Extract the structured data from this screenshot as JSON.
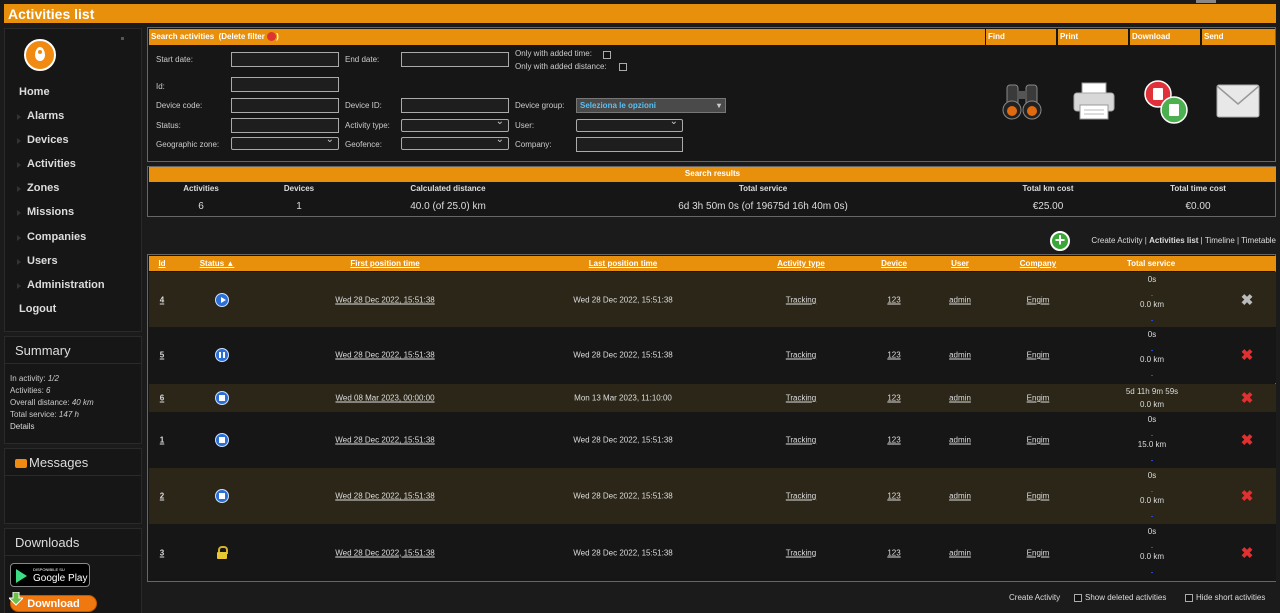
{
  "title": "Activities list",
  "nav": [
    "Home",
    "Alarms",
    "Devices",
    "Activities",
    "Zones",
    "Missions",
    "Companies",
    "Users",
    "Administration",
    "Logout"
  ],
  "summary": {
    "title": "Summary",
    "in_activity_label": "In activity:",
    "in_activity": "1/2",
    "activities_label": "Activities:",
    "activities": "6",
    "distance_label": "Overall distance:",
    "distance": "40 km",
    "service_label": "Total service:",
    "service": "147 h",
    "details": "Details"
  },
  "messages_title": "Messages",
  "downloads": {
    "title": "Downloads",
    "gplay_small": "DISPONIBILE SU",
    "gplay_big": "Google Play",
    "download": "Download"
  },
  "search": {
    "header": "Search activities",
    "delete_filter": "Delete filter",
    "start_date": "Start date:",
    "end_date": "End date:",
    "only_time": "Only with added time:",
    "only_distance": "Only with added distance:",
    "id": "Id:",
    "device_code": "Device code:",
    "device_id": "Device ID:",
    "device_group": "Device group:",
    "device_group_placeholder": "Seleziona le opzioni",
    "status": "Status:",
    "activity_type": "Activity type:",
    "user": "User:",
    "geo_zone": "Geographic zone:",
    "geofence": "Geofence:",
    "company": "Company:",
    "find": "Find",
    "print": "Print",
    "download": "Download",
    "send": "Send"
  },
  "results": {
    "header": "Search results",
    "cols": [
      "Activities",
      "Devices",
      "Calculated distance",
      "Total service",
      "Total km cost",
      "Total time cost"
    ],
    "values": [
      "6",
      "1",
      "40.0 (of 25.0) km",
      "6d 3h 50m 0s (of 19675d 16h 40m 0s)",
      "€25.00",
      "€0.00"
    ]
  },
  "links": {
    "create": "Create Activity",
    "list": "Activities list",
    "timeline": "Timeline",
    "timetable": "Timetable"
  },
  "table": {
    "headers": [
      "Id",
      "Status",
      "First position time",
      "Last position time",
      "Activity type",
      "Device",
      "User",
      "Company",
      "Total service"
    ],
    "rows": [
      {
        "id": "4",
        "status": "play",
        "first": "Wed 28 Dec 2022, 15:51:38",
        "last": "Wed 28 Dec 2022, 15:51:38",
        "type": "Tracking",
        "device": "123",
        "user": "admin",
        "company": "Engim",
        "svc1": "0s",
        "svc2": "0.0 km"
      },
      {
        "id": "5",
        "status": "pause",
        "first": "Wed 28 Dec 2022, 15:51:38",
        "last": "Wed 28 Dec 2022, 15:51:38",
        "type": "Tracking",
        "device": "123",
        "user": "admin",
        "company": "Engim",
        "svc1": "0s",
        "svc2": "0.0 km"
      },
      {
        "id": "6",
        "status": "stop",
        "first": "Wed 08 Mar 2023, 00:00:00",
        "last": "Mon 13 Mar 2023, 11:10:00",
        "type": "Tracking",
        "device": "123",
        "user": "admin",
        "company": "Engim",
        "svc1": "5d 11h 9m 59s",
        "svc2": "0.0 km"
      },
      {
        "id": "1",
        "status": "stop",
        "first": "Wed 28 Dec 2022, 15:51:38",
        "last": "Wed 28 Dec 2022, 15:51:38",
        "type": "Tracking",
        "device": "123",
        "user": "admin",
        "company": "Engim",
        "svc1": "0s",
        "svc2": "15.0 km"
      },
      {
        "id": "2",
        "status": "stop",
        "first": "Wed 28 Dec 2022, 15:51:38",
        "last": "Wed 28 Dec 2022, 15:51:38",
        "type": "Tracking",
        "device": "123",
        "user": "admin",
        "company": "Engim",
        "svc1": "0s",
        "svc2": "0.0 km"
      },
      {
        "id": "3",
        "status": "lock",
        "first": "Wed 28 Dec 2022, 15:51:38",
        "last": "Wed 28 Dec 2022, 15:51:38",
        "type": "Tracking",
        "device": "123",
        "user": "admin",
        "company": "Engim",
        "svc1": "0s",
        "svc2": "0.0 km"
      }
    ]
  },
  "footer": {
    "create": "Create Activity",
    "show_deleted": "Show deleted activities",
    "hide_short": "Hide short activities"
  }
}
